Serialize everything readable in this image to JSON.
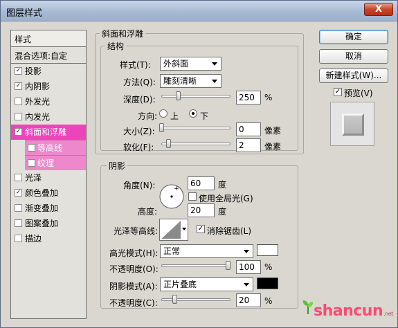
{
  "window": {
    "title": "图层样式",
    "close_label": "X"
  },
  "styles_list": {
    "header": "样式",
    "blending_options": "混合选项:自定",
    "items": [
      {
        "label": "投影",
        "checked": true
      },
      {
        "label": "内阴影",
        "checked": true
      },
      {
        "label": "外发光",
        "checked": false
      },
      {
        "label": "内发光",
        "checked": false
      },
      {
        "label": "斜面和浮雕",
        "checked": true
      },
      {
        "label": "等高线",
        "checked": false
      },
      {
        "label": "纹理",
        "checked": false
      },
      {
        "label": "光泽",
        "checked": false
      },
      {
        "label": "颜色叠加",
        "checked": true
      },
      {
        "label": "渐变叠加",
        "checked": false
      },
      {
        "label": "图案叠加",
        "checked": false
      },
      {
        "label": "描边",
        "checked": false
      }
    ],
    "check_glyph": "✓"
  },
  "bevel": {
    "section_title": "斜面和浮雕",
    "structure_title": "结构",
    "style_label": "样式(T):",
    "style_value": "外斜面",
    "technique_label": "方法(Q):",
    "technique_value": "雕刻清晰",
    "depth_label": "深度(D):",
    "depth_value": "250",
    "depth_unit": "%",
    "direction_label": "方向:",
    "direction_up": "上",
    "direction_down": "下",
    "size_label": "大小(Z):",
    "size_value": "0",
    "size_unit": "像素",
    "soften_label": "软化(F):",
    "soften_value": "2",
    "soften_unit": "像素"
  },
  "shading": {
    "title": "阴影",
    "angle_label": "角度(N):",
    "angle_value": "60",
    "angle_unit": "度",
    "global_light_label": "使用全局光(G)",
    "altitude_label": "高度:",
    "altitude_value": "20",
    "altitude_unit": "度",
    "gloss_contour_label": "光泽等高线:",
    "anti_alias_label": "消除锯齿(L)",
    "highlight_mode_label": "高光模式(H):",
    "highlight_mode_value": "正常",
    "highlight_color": "#ffffff",
    "highlight_opacity_label": "不透明度(O):",
    "highlight_opacity_value": "100",
    "highlight_opacity_unit": "%",
    "shadow_mode_label": "阴影模式(A):",
    "shadow_mode_value": "正片叠底",
    "shadow_color": "#000000",
    "shadow_opacity_label": "不透明度(C):",
    "shadow_opacity_value": "20",
    "shadow_opacity_unit": "%"
  },
  "sliders": {
    "depth_fraction": 0.25,
    "size_fraction": 0.0,
    "soften_fraction": 0.1,
    "highlight_opacity_fraction": 1.0,
    "shadow_opacity_fraction": 0.2
  },
  "buttons": {
    "ok": "确定",
    "cancel": "取消",
    "new_style": "新建样式(W)...",
    "preview_label": "预览(V)"
  },
  "watermark": {
    "brand": "shancun",
    "tld": ".net"
  }
}
